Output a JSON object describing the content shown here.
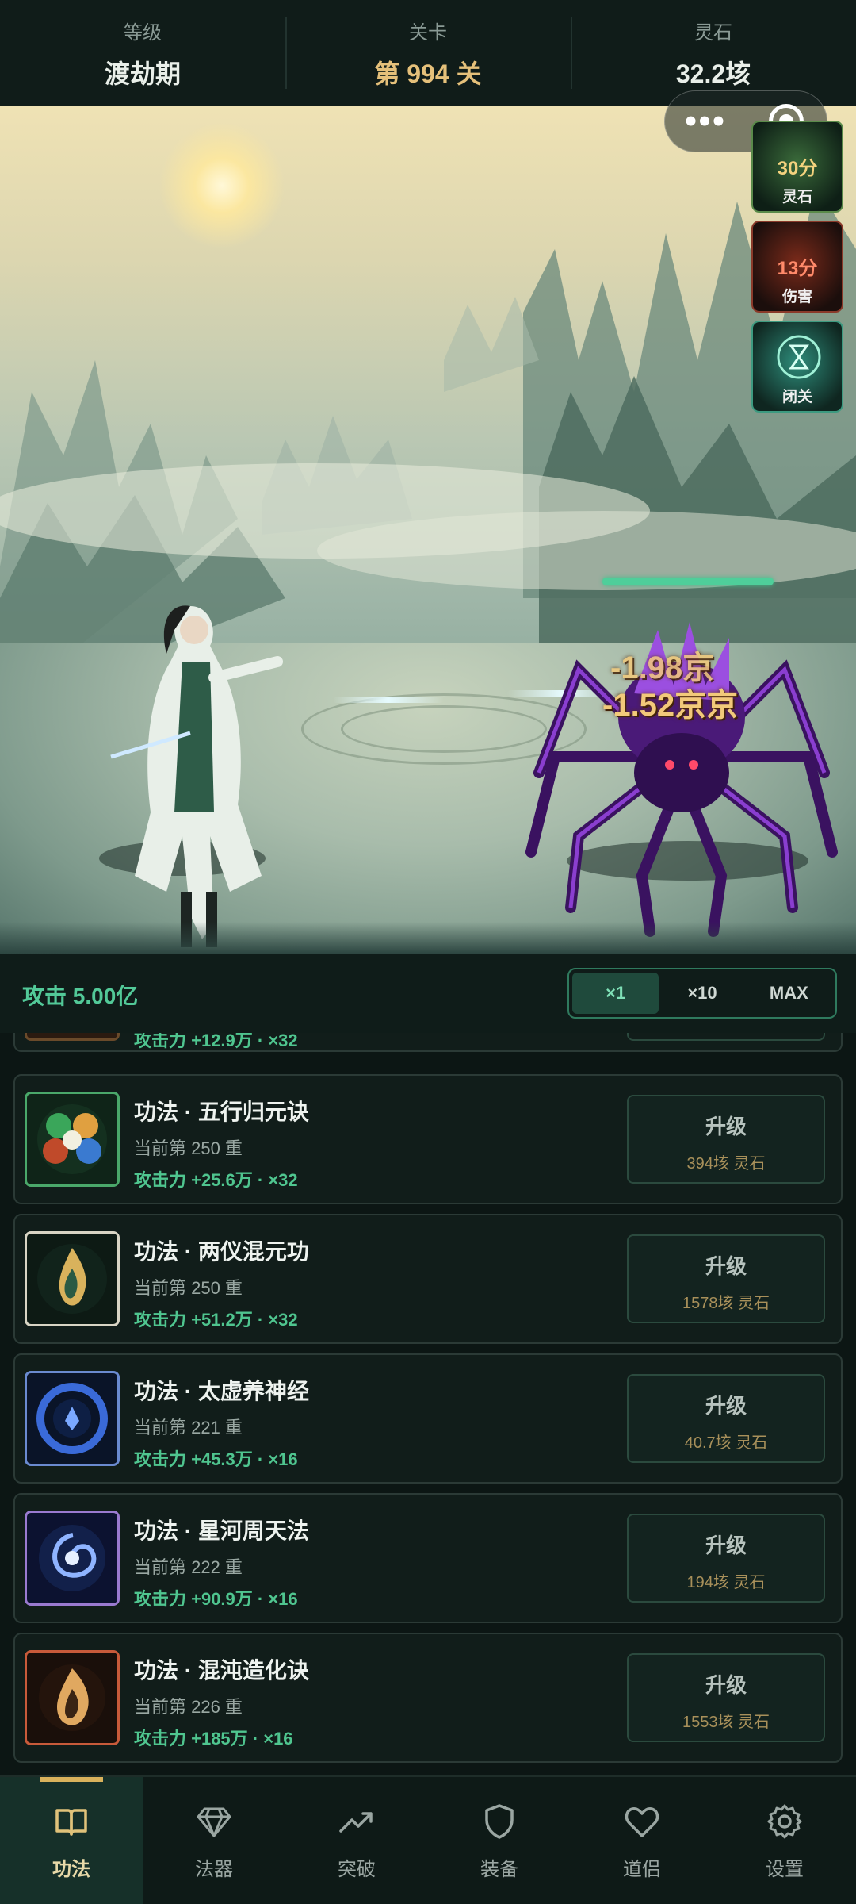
{
  "topbar": {
    "realm": {
      "label": "等级",
      "value": "渡劫期"
    },
    "stage": {
      "label": "关卡",
      "value": "第 994 关"
    },
    "stones": {
      "label": "灵石",
      "value": "32.2垓"
    }
  },
  "scene": {
    "damage_numbers": [
      "-1.98京",
      "-1.52京京"
    ],
    "enemy_hp_fraction": 1.0,
    "capsule": {
      "more_icon": "more-dots-icon",
      "close_icon": "target-circle-icon"
    },
    "side_buttons": [
      {
        "value": "30分",
        "label": "灵石",
        "color": "#f4d27e"
      },
      {
        "value": "13分",
        "label": "伤害",
        "color": "#ff8a6a"
      },
      {
        "value": "",
        "label": "闭关",
        "color": "#7fe0c4"
      }
    ]
  },
  "attack_bar": {
    "attack": "攻击 5.00亿",
    "multipliers": [
      "×1",
      "×10",
      "MAX"
    ],
    "active_multiplier": "×1"
  },
  "skills": {
    "partial_top_text": "攻击力 +12.9万 · ×32",
    "items": [
      {
        "title": "功法 · 五行归元诀",
        "level": "当前第 250 重",
        "attack": "攻击力 +25.6万 · ×32",
        "button": "升级",
        "cost": "394垓 灵石",
        "icon": "five-elements-icon"
      },
      {
        "title": "功法 · 两仪混元功",
        "level": "当前第 250 重",
        "attack": "攻击力 +51.2万 · ×32",
        "button": "升级",
        "cost": "1578垓 灵石",
        "icon": "golden-flame-icon"
      },
      {
        "title": "功法 · 太虚养神经",
        "level": "当前第 221 重",
        "attack": "攻击力 +45.3万 · ×16",
        "button": "升级",
        "cost": "40.7垓 灵石",
        "icon": "void-orb-icon"
      },
      {
        "title": "功法 · 星河周天法",
        "level": "当前第 222 重",
        "attack": "攻击力 +90.9万 · ×16",
        "button": "升级",
        "cost": "194垓 灵石",
        "icon": "galaxy-swirl-icon"
      },
      {
        "title": "功法 · 混沌造化诀",
        "level": "当前第 226 重",
        "attack": "攻击力 +185万 · ×16",
        "button": "升级",
        "cost": "1553垓 灵石",
        "icon": "chaos-flame-icon"
      }
    ]
  },
  "nav": {
    "items": [
      {
        "label": "功法",
        "icon": "book-icon"
      },
      {
        "label": "法器",
        "icon": "gem-icon"
      },
      {
        "label": "突破",
        "icon": "trend-up-icon"
      },
      {
        "label": "装备",
        "icon": "shield-icon"
      },
      {
        "label": "道侣",
        "icon": "heart-icon"
      },
      {
        "label": "设置",
        "icon": "gear-icon"
      }
    ],
    "active": "功法"
  }
}
